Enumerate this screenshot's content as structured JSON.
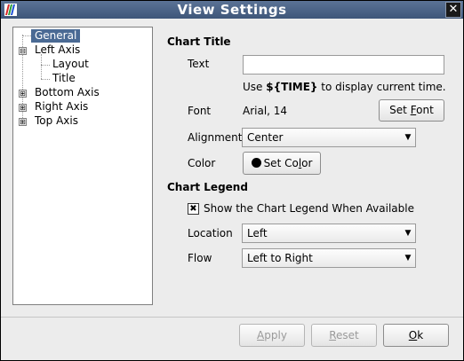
{
  "window": {
    "title": "View Settings",
    "app_icon": "app-stripes-icon",
    "close_icon": "close-icon",
    "close_glyph": "✕"
  },
  "tree": {
    "items": [
      {
        "label": "General",
        "selected": true
      },
      {
        "label": "Left Axis",
        "expanded": true,
        "expander": "⊟"
      },
      {
        "label": "Layout"
      },
      {
        "label": "Title"
      },
      {
        "label": "Bottom Axis",
        "expander": "⊞"
      },
      {
        "label": "Right Axis",
        "expander": "⊞"
      },
      {
        "label": "Top Axis",
        "expander": "⊞"
      }
    ]
  },
  "chart_title": {
    "heading": "Chart Title",
    "text_label": "Text",
    "text_value": "",
    "hint_prefix": "Use ",
    "hint_token": "${TIME}",
    "hint_suffix": " to display current time.",
    "font_label": "Font",
    "font_value": "Arial, 14",
    "set_font_pre": "Set ",
    "set_font_u": "F",
    "set_font_post": "ont",
    "alignment_label": "Alignment",
    "alignment_value": "Center",
    "color_label": "Color",
    "set_color_pre": "Set Co",
    "set_color_u": "l",
    "set_color_post": "or",
    "color_swatch": "#000000"
  },
  "chart_legend": {
    "heading": "Chart Legend",
    "show_checked": true,
    "check_glyph": "✖",
    "show_label": "Show the Chart Legend When Available",
    "location_label": "Location",
    "location_value": "Left",
    "flow_label": "Flow",
    "flow_value": "Left to Right"
  },
  "buttons": {
    "apply_u": "A",
    "apply_rest": "pply",
    "reset_u": "R",
    "reset_rest": "eset",
    "ok_u": "O",
    "ok_rest": "k"
  },
  "combo_arrow": "▼"
}
